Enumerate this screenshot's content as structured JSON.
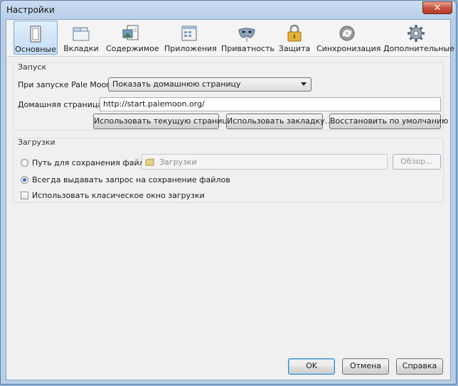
{
  "window": {
    "title": "Настройки",
    "close_glyph": "✕"
  },
  "toolbar": {
    "tabs": [
      {
        "label": "Основные",
        "icon": "switch-icon",
        "active": true
      },
      {
        "label": "Вкладки",
        "icon": "tabs-icon"
      },
      {
        "label": "Содержимое",
        "icon": "content-icon"
      },
      {
        "label": "Приложения",
        "icon": "applications-icon"
      },
      {
        "label": "Приватность",
        "icon": "mask-icon"
      },
      {
        "label": "Защита",
        "icon": "lock-icon"
      },
      {
        "label": "Синхронизация",
        "icon": "sync-icon"
      },
      {
        "label": "Дополнительные",
        "icon": "gear-icon"
      }
    ]
  },
  "startup": {
    "group_title": "Запуск",
    "on_start_label": "При запуске Pale Moon:",
    "on_start_value": "Показать домашнюю страницу",
    "homepage_label": "Домашняя страница:",
    "homepage_value": "http://start.palemoon.org/",
    "use_current_button": "Использовать текущую страницу",
    "use_bookmark_button": "Использовать закладку...",
    "restore_default_button": "Восстановить по умолчанию"
  },
  "downloads": {
    "group_title": "Загрузки",
    "save_path_label": "Путь для сохранения файлов",
    "folder_value": "Загрузки",
    "browse_button": "Обзор...",
    "always_ask_label": "Всегда выдавать запрос на сохранение файлов",
    "classic_window_label": "Использовать класическое окно загрузки"
  },
  "footer": {
    "ok_button": "OK",
    "cancel_button": "Отмена",
    "help_button": "Справка"
  },
  "colors": {
    "accent": "#7ea9d8",
    "window_frame": "#b7cee8",
    "close": "#c9523f"
  }
}
